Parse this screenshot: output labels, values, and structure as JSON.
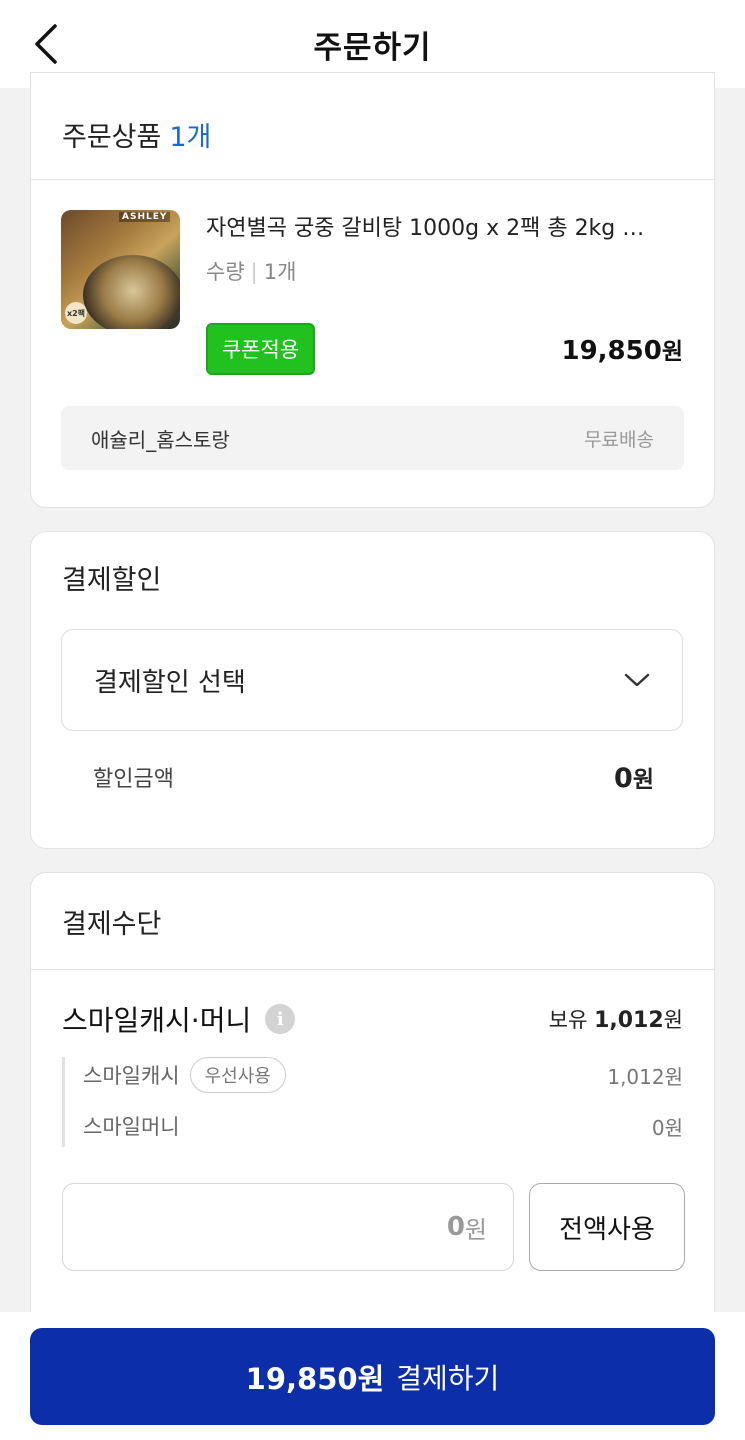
{
  "header": {
    "title": "주문하기"
  },
  "order_items": {
    "heading": "주문상품",
    "count": "1개",
    "product": {
      "name": "자연별곡 궁중 갈비탕 1000g x 2팩 총 2kg …",
      "qty_label": "수량",
      "qty_value": "1개",
      "coupon_label": "쿠폰적용",
      "price": "19,850",
      "currency": "원",
      "thumb_brand": "ASHLEY",
      "thumb_badge": "x2팩"
    },
    "seller": "애슐리_홈스토랑",
    "shipping": "무료배송"
  },
  "discount": {
    "heading": "결제할인",
    "select_label": "결제할인 선택",
    "amount_label": "할인금액",
    "amount_value": "0",
    "currency": "원"
  },
  "payment": {
    "heading": "결제수단",
    "method": "스마일캐시·머니",
    "holding_label": "보유",
    "holding_value": "1,012",
    "currency": "원",
    "cash_label": "스마일캐시",
    "cash_badge": "우선사용",
    "cash_value": "1,012원",
    "money_label": "스마일머니",
    "money_value": "0원",
    "input_value": "0",
    "input_unit": "원",
    "use_all_label": "전액사용"
  },
  "bottom": {
    "amount": "19,850원",
    "action": "결제하기"
  },
  "colors": {
    "brand_blue": "#0c2ea8",
    "coupon_green": "#21c21f",
    "count_blue": "#1a6bd1"
  }
}
